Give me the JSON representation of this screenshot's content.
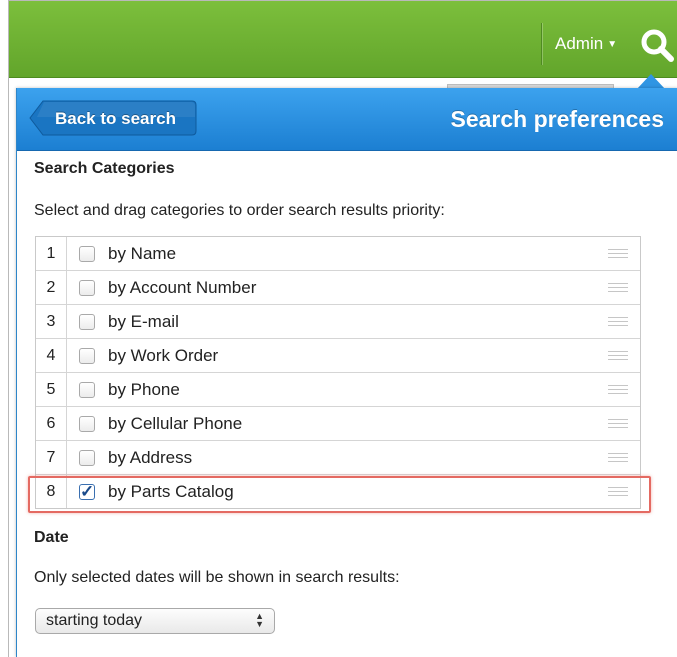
{
  "topbar": {
    "user_menu_label": "Admin",
    "caret_icon": "caret-down-icon",
    "search_icon": "search-icon",
    "colors": {
      "bar": "#6aae30"
    }
  },
  "panel": {
    "back_label": "Back to search",
    "title": "Search preferences",
    "colors": {
      "header": "#2a90e0"
    }
  },
  "categories_section": {
    "title": "Search Categories",
    "instructions": "Select and drag categories to order search results priority:",
    "items": [
      {
        "num": "1",
        "label": "by Name",
        "checked": false
      },
      {
        "num": "2",
        "label": "by Account Number",
        "checked": false
      },
      {
        "num": "3",
        "label": "by E-mail",
        "checked": false
      },
      {
        "num": "4",
        "label": "by Work Order",
        "checked": false
      },
      {
        "num": "5",
        "label": "by Phone",
        "checked": false
      },
      {
        "num": "6",
        "label": "by Cellular Phone",
        "checked": false
      },
      {
        "num": "7",
        "label": "by Address",
        "checked": false
      },
      {
        "num": "8",
        "label": "by Parts Catalog",
        "checked": true
      }
    ],
    "highlight_color": "#e46a62"
  },
  "date_section": {
    "title": "Date",
    "instructions": "Only selected dates will be shown in search results:",
    "select_value": "starting today"
  }
}
